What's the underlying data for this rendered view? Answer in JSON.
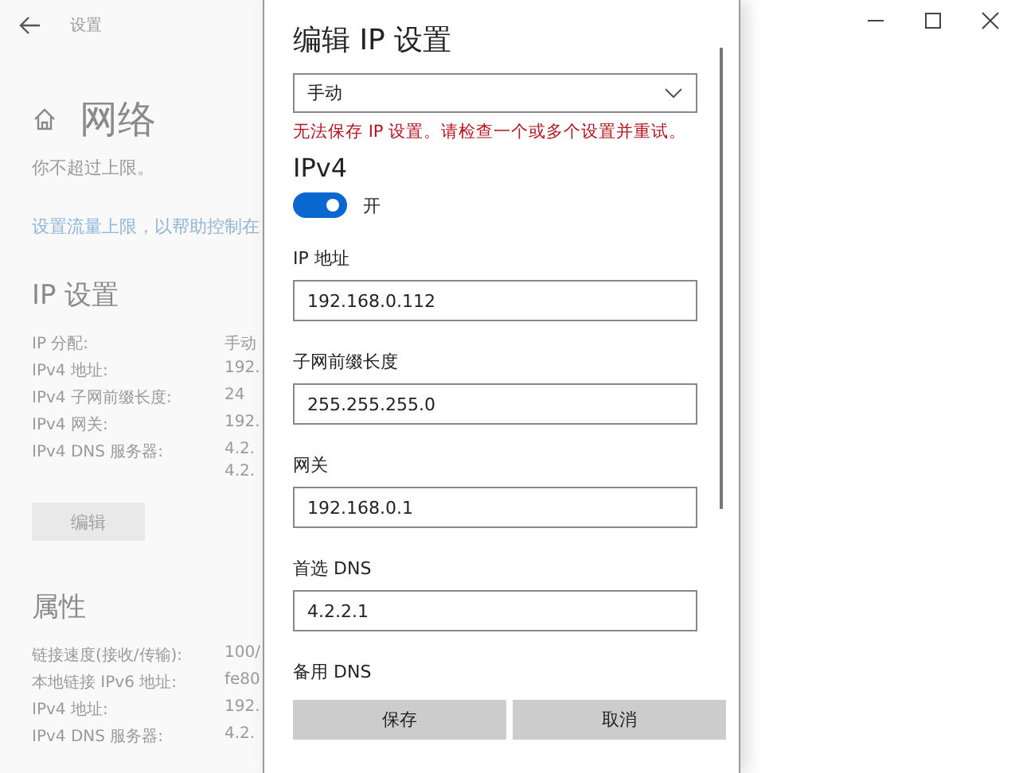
{
  "window": {
    "title": "设置"
  },
  "page": {
    "heading": "网络",
    "text": "你不超过上限。",
    "link": "设置流量上限，以帮助控制在"
  },
  "ip_section": {
    "heading": "IP 设置",
    "rows": [
      {
        "label": "IP 分配:",
        "values": [
          "手动"
        ]
      },
      {
        "label": "IPv4 地址:",
        "values": [
          "192."
        ]
      },
      {
        "label": "IPv4 子网前缀长度:",
        "values": [
          "24"
        ]
      },
      {
        "label": "IPv4 网关:",
        "values": [
          "192."
        ]
      },
      {
        "label": "IPv4 DNS 服务器:",
        "values": [
          "4.2.",
          "4.2."
        ]
      }
    ],
    "button": "编辑"
  },
  "properties": {
    "heading": "属性",
    "rows": [
      {
        "label": "链接速度(接收/传输):",
        "values": [
          "100/"
        ]
      },
      {
        "label": "本地链接 IPv6 地址:",
        "values": [
          "fe80"
        ]
      },
      {
        "label": "IPv4 地址:",
        "values": [
          "192."
        ]
      },
      {
        "label": "IPv4 DNS 服务器:",
        "values": [
          "4.2."
        ]
      }
    ]
  },
  "dialog": {
    "title": "编辑 IP 设置",
    "mode": "手动",
    "error": "无法保存 IP 设置。请检查一个或多个设置并重试。",
    "section": "IPv4",
    "toggle": {
      "on": true,
      "label": "开"
    },
    "fields": [
      {
        "label": "IP 地址",
        "value": "192.168.0.112"
      },
      {
        "label": "子网前缀长度",
        "value": "255.255.255.0"
      },
      {
        "label": "网关",
        "value": "192.168.0.1"
      },
      {
        "label": "首选 DNS",
        "value": "4.2.2.1"
      },
      {
        "label": "备用 DNS"
      }
    ],
    "buttons": [
      "保存",
      "取消"
    ]
  }
}
